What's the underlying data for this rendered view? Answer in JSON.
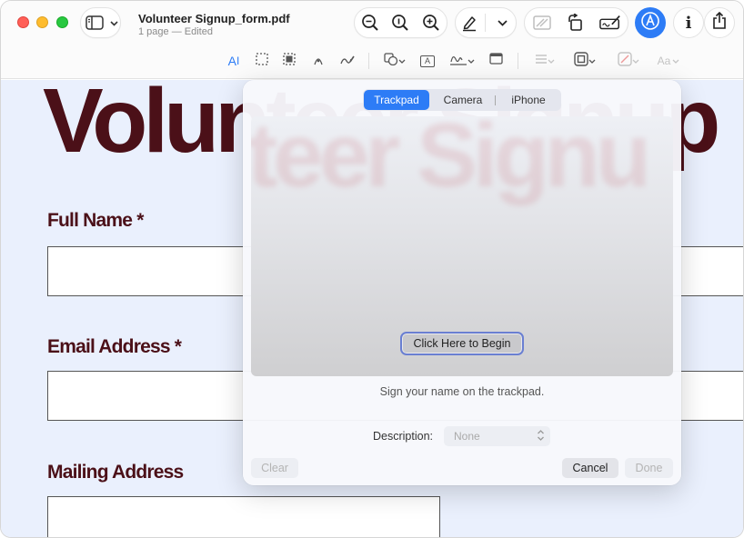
{
  "window": {
    "doc_title": "Volunteer Signup_form.pdf",
    "doc_subtitle": "1 page — Edited"
  },
  "toolbar": {
    "icons": [
      "sidebar-toggle-icon",
      "zoom-out-icon",
      "zoom-fit-icon",
      "zoom-in-icon",
      "highlight-pen-icon",
      "chevron-down-icon",
      "redact-icon",
      "rotate-icon",
      "sign-icon",
      "markup-icon",
      "info-icon",
      "share-icon"
    ],
    "info_label": "i",
    "markup_color": "#2d7cf6"
  },
  "markup_toolbar": {
    "text_selection_label": "A",
    "text_box_label": "A",
    "font_label": "Aa"
  },
  "document": {
    "big_title": "Volunteer Signup",
    "fields": [
      {
        "label": "Full Name *"
      },
      {
        "label": "Email Address *"
      },
      {
        "label": "Mailing Address"
      }
    ],
    "title_color": "#4b1018"
  },
  "signature_popover": {
    "tabs": [
      "Trackpad",
      "Camera",
      "iPhone"
    ],
    "active_tab": "Trackpad",
    "begin_button": "Click Here to Begin",
    "hint": "Sign your name on the trackpad.",
    "description_label": "Description:",
    "description_value": "None",
    "clear_button": "Clear",
    "cancel_button": "Cancel",
    "done_button": "Done",
    "accent_color": "#2d7cf6"
  }
}
